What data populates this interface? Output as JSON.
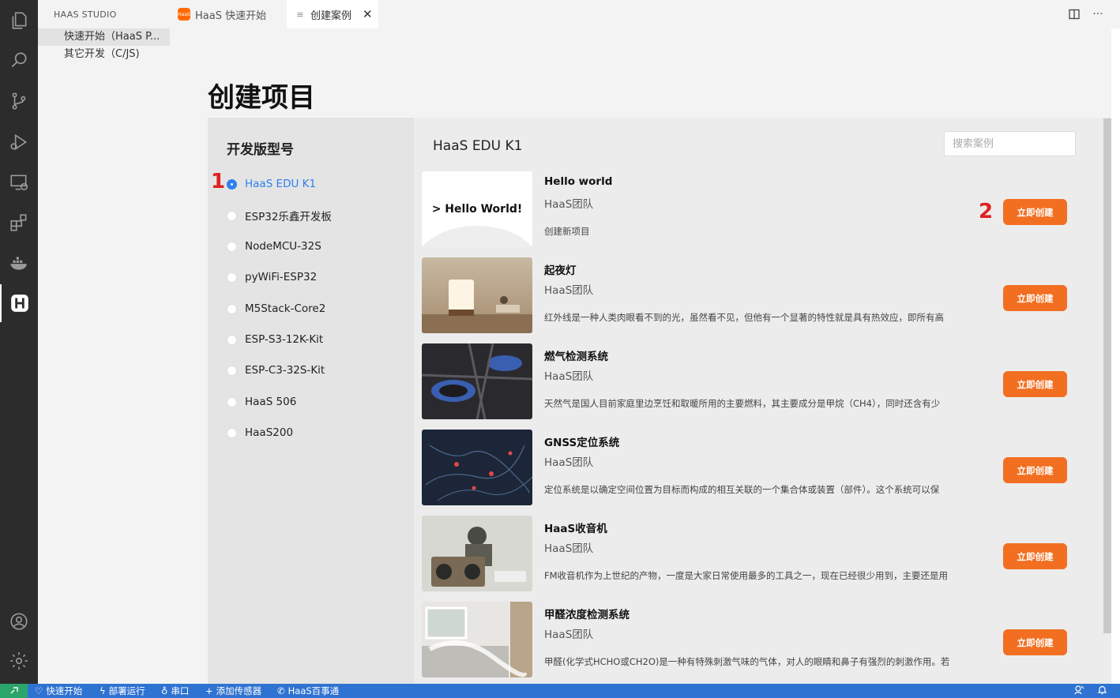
{
  "sidebar": {
    "title": "HAAS STUDIO",
    "items": [
      {
        "label": "快速开始（HaaS P..."
      },
      {
        "label": "其它开发（C/JS)"
      }
    ]
  },
  "tabs": [
    {
      "label": "HaaS 快速开始",
      "icon": "haas-logo-icon",
      "logo_text": "HaaS"
    },
    {
      "label": "创建案例",
      "icon": "document-icon"
    }
  ],
  "page": {
    "title": "创建项目",
    "left_title": "开发版型号",
    "right_title": "HaaS EDU K1",
    "search_placeholder": "搜索案例",
    "markers": [
      "1",
      "2"
    ],
    "boards": [
      {
        "label": "HaaS EDU K1",
        "selected": true
      },
      {
        "label": "ESP32乐鑫开发板",
        "selected": false
      },
      {
        "label": "NodeMCU-32S",
        "selected": false
      },
      {
        "label": "pyWiFi-ESP32",
        "selected": false
      },
      {
        "label": "M5Stack-Core2",
        "selected": false
      },
      {
        "label": "ESP-S3-12K-Kit",
        "selected": false
      },
      {
        "label": "ESP-C3-32S-Kit",
        "selected": false
      },
      {
        "label": "HaaS 506",
        "selected": false
      },
      {
        "label": "HaaS200",
        "selected": false
      }
    ],
    "cards": [
      {
        "title": "Hello world",
        "author": "HaaS团队",
        "desc": "创建新项目",
        "button": "立即创建",
        "thumb_text": "> Hello World!"
      },
      {
        "title": "起夜灯",
        "author": "HaaS团队",
        "desc": "红外线是一种人类肉眼看不到的光，虽然看不见，但他有一个显著的特性就是具有热效应，即所有高",
        "button": "立即创建"
      },
      {
        "title": "燃气检测系统",
        "author": "HaaS团队",
        "desc": "天然气是国人目前家庭里边烹饪和取暖所用的主要燃料，其主要成分是甲烷（CH4），同时还含有少",
        "button": "立即创建"
      },
      {
        "title": "GNSS定位系统",
        "author": "HaaS团队",
        "desc": "定位系统是以确定空间位置为目标而构成的相互关联的一个集合体或装置（部件）。这个系统可以保",
        "button": "立即创建"
      },
      {
        "title": "HaaS收音机",
        "author": "HaaS团队",
        "desc": "FM收音机作为上世纪的产物，一度是大家日常使用最多的工具之一，现在已经很少用到，主要还是用",
        "button": "立即创建"
      },
      {
        "title": "甲醛浓度检测系统",
        "author": "HaaS团队",
        "desc": "甲醛(化学式HCHO或CH2O)是一种有特殊刺激气味的气体，对人的眼睛和鼻子有强烈的刺激作用。若",
        "button": "立即创建"
      }
    ]
  },
  "statusbar": {
    "items": [
      {
        "label": "快速开始",
        "icon": "heart-icon"
      },
      {
        "label": "部署运行",
        "icon": "lightning-icon"
      },
      {
        "label": "串口",
        "icon": "plug-icon"
      },
      {
        "label": "添加传感器",
        "icon": "plus-icon"
      },
      {
        "label": "HaaS百事通",
        "icon": "phone-icon"
      }
    ]
  },
  "colors": {
    "accent_orange": "#f26f21",
    "selected_blue": "#2f80ed",
    "statusbar_blue": "#2f73d2",
    "marker_red": "#e02020"
  }
}
